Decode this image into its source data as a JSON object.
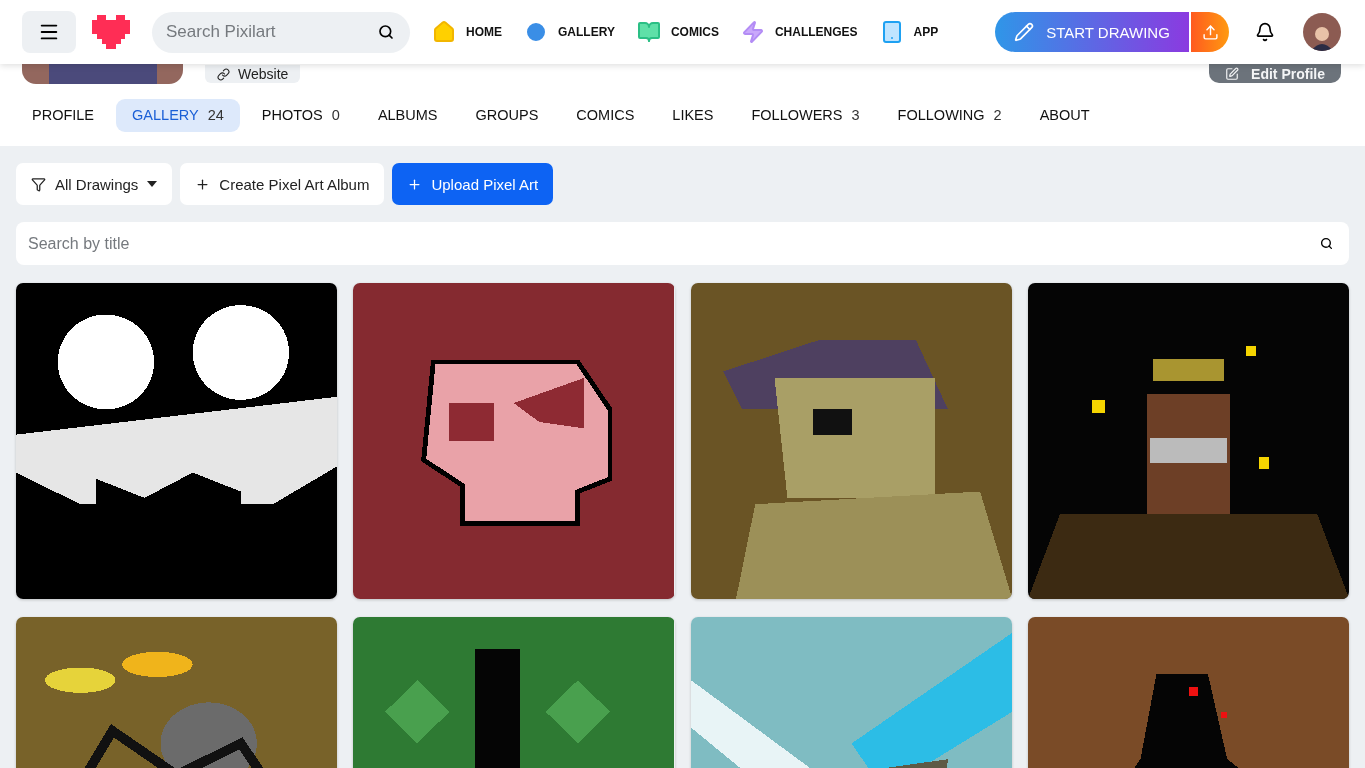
{
  "header": {
    "search": {
      "placeholder": "Search Pixilart"
    },
    "nav": [
      {
        "label": "HOME",
        "kind": "home"
      },
      {
        "label": "GALLERY",
        "kind": "gallery"
      },
      {
        "label": "COMICS",
        "kind": "comics"
      },
      {
        "label": "CHALLENGES",
        "kind": "challenges"
      },
      {
        "label": "APP",
        "kind": "app"
      }
    ],
    "start_drawing": "START DRAWING"
  },
  "profile": {
    "website": "Website",
    "edit": "Edit Profile"
  },
  "tabs": [
    {
      "label": "PROFILE",
      "selected": false
    },
    {
      "label": "GALLERY",
      "count": "24",
      "selected": true
    },
    {
      "label": "PHOTOS",
      "count": "0",
      "selected": false
    },
    {
      "label": "ALBUMS",
      "selected": false
    },
    {
      "label": "GROUPS",
      "selected": false
    },
    {
      "label": "COMICS",
      "selected": false
    },
    {
      "label": "LIKES",
      "selected": false
    },
    {
      "label": "FOLLOWERS",
      "count": "3",
      "selected": false
    },
    {
      "label": "FOLLOWING",
      "count": "2",
      "selected": false
    },
    {
      "label": "ABOUT",
      "selected": false
    }
  ],
  "toolbar": {
    "filter": "All Drawings",
    "create": "Create Pixel Art Album",
    "upload": "Upload Pixel Art"
  },
  "search": {
    "placeholder": "Search by title"
  }
}
